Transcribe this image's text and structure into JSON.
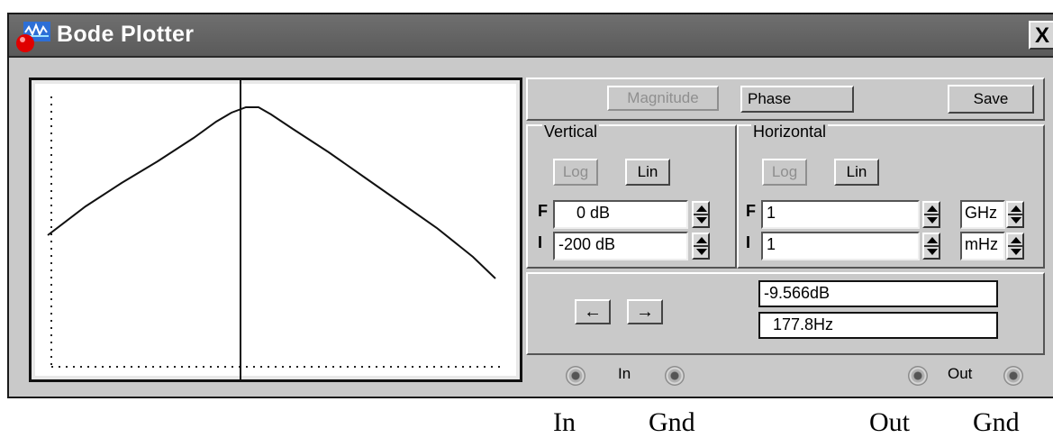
{
  "window": {
    "title": "Bode Plotter",
    "close_glyph": "X"
  },
  "graph": {
    "curve": "peaked response",
    "cursor": "vertical cursor at peak"
  },
  "mode": {
    "magnitude_label": "Magnitude",
    "phase_label": "Phase",
    "save_label": "Save",
    "active": "Phase"
  },
  "vertical": {
    "title": "Vertical",
    "log_label": "Log",
    "lin_label": "Lin",
    "final_letter": "F",
    "initial_letter": "I",
    "final_value": "0 dB",
    "initial_value": "-200 dB"
  },
  "horizontal": {
    "title": "Horizontal",
    "log_label": "Log",
    "lin_label": "Lin",
    "final_letter": "F",
    "initial_letter": "I",
    "final_value": "1",
    "initial_value": "1",
    "final_unit": "GHz",
    "initial_unit": "mHz"
  },
  "readout": {
    "left_arrow": "←",
    "right_arrow": "→",
    "value": "-9.566dB",
    "frequency": "177.8Hz"
  },
  "terminals": {
    "in_label": "In",
    "out_label": "Out"
  },
  "captions": {
    "in": "In",
    "gnd_in": "Gnd",
    "out": "Out",
    "gnd_out": "Gnd"
  }
}
